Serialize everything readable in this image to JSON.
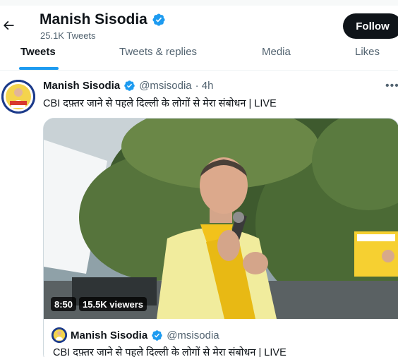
{
  "header": {
    "profile_name": "Manish Sisodia",
    "tweet_count": "25.1K Tweets",
    "follow_label": "Follow",
    "back_icon": "arrow-left-icon"
  },
  "tabs": [
    {
      "label": "Tweets",
      "active": true
    },
    {
      "label": "Tweets & replies",
      "active": false
    },
    {
      "label": "Media",
      "active": false
    },
    {
      "label": "Likes",
      "active": false
    }
  ],
  "tweet": {
    "author_name": "Manish Sisodia",
    "handle": "@msisodia",
    "time": "· 4h",
    "text": "CBI दफ़्तर जाने से पहले दिल्ली के लोगों से मेरा संबोधन | LIVE",
    "more_icon": "more-icon",
    "video": {
      "duration": "8:50",
      "viewers": "15.5K viewers"
    },
    "quote": {
      "author_name": "Manish Sisodia",
      "handle": "@msisodia",
      "text": "CBI दफ़्तर जाने से पहले दिल्ली के लोगों से मेरा संबोधन | LIVE"
    }
  },
  "colors": {
    "verified_blue": "#1d9bf0",
    "follow_bg": "#0f1419",
    "secondary_text": "#536471",
    "saffron_scarf": "#f2c21b"
  }
}
